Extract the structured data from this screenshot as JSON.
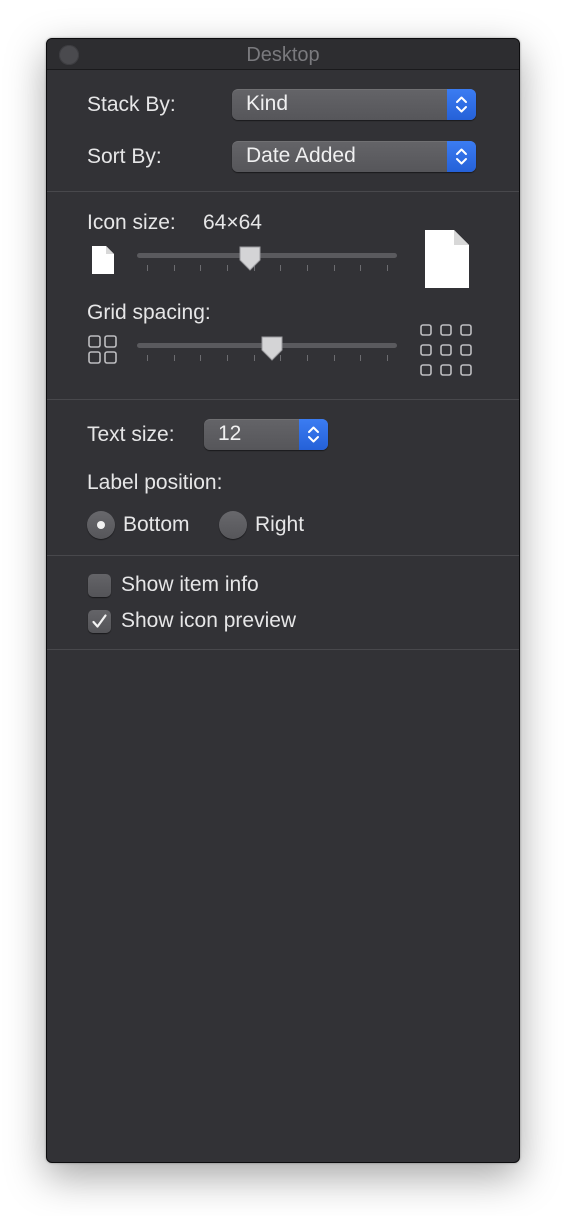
{
  "window": {
    "title": "Desktop"
  },
  "arrange": {
    "stack_by_label": "Stack By:",
    "stack_by_value": "Kind",
    "sort_by_label": "Sort By:",
    "sort_by_value": "Date Added"
  },
  "icons": {
    "icon_size_label": "Icon size:",
    "icon_size_value": "64×64",
    "icon_size_slider_level": 0.43,
    "grid_spacing_label": "Grid spacing:",
    "grid_spacing_slider_level": 0.52
  },
  "text": {
    "text_size_label": "Text size:",
    "text_size_value": "12",
    "label_position_label": "Label position:",
    "options": [
      {
        "label": "Bottom",
        "selected": true
      },
      {
        "label": "Right",
        "selected": false
      }
    ]
  },
  "options": {
    "show_item_info_label": "Show item info",
    "show_item_info_checked": false,
    "show_icon_preview_label": "Show icon preview",
    "show_icon_preview_checked": true
  },
  "colors": {
    "panel_background": "#323236",
    "accent_blue": "#2f6fe6",
    "control_gray": "#5e5e62"
  }
}
